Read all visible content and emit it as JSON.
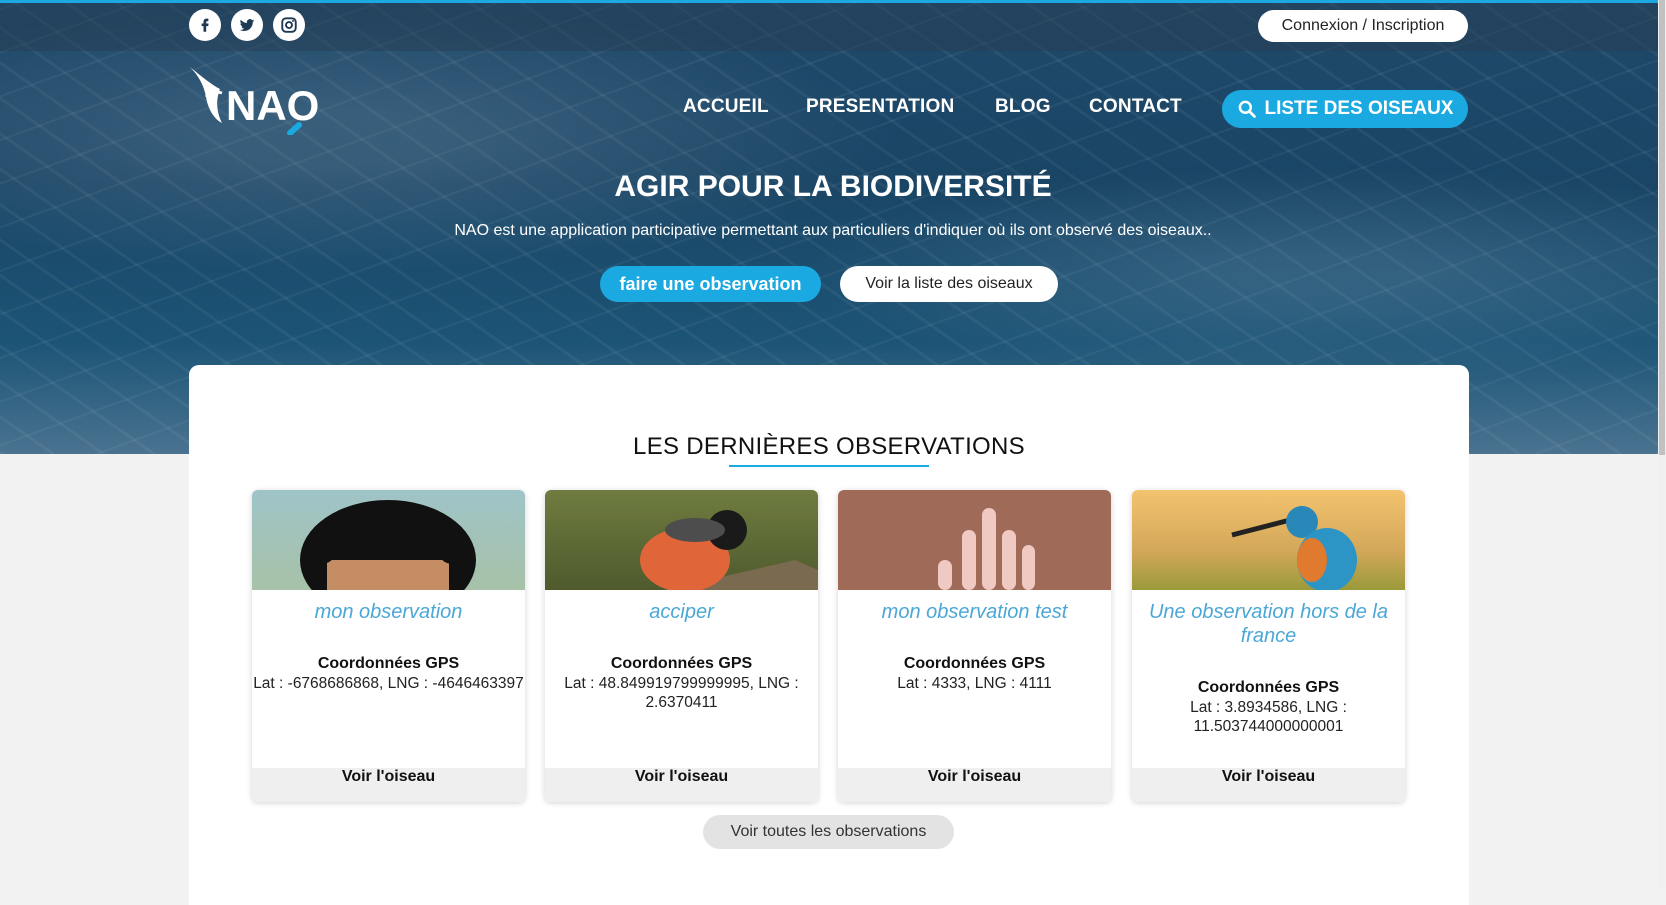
{
  "topbar": {
    "social": [
      {
        "icon": "facebook-icon"
      },
      {
        "icon": "twitter-icon"
      },
      {
        "icon": "instagram-icon"
      }
    ],
    "login_label": "Connexion / Inscription"
  },
  "nav": {
    "logo_text": "NAO",
    "links": [
      "ACCUEIL",
      "PRESENTATION",
      "BLOG",
      "CONTACT"
    ],
    "cta_label": "LISTE DES OISEAUX"
  },
  "hero": {
    "title": "AGIR POUR LA BIODIVERSITÉ",
    "subtitle": "NAO est une application participative permettant aux particuliers d'indiquer où ils ont observé des oiseaux..",
    "primary_btn": "faire une observation",
    "secondary_btn": "Voir la liste des oiseaux"
  },
  "observations": {
    "heading": "LES DERNIÈRES OBSERVATIONS",
    "cards": [
      {
        "title": "mon observation",
        "gps_label": "Coordonnées GPS",
        "gps_value": "Lat : -6768686868, LNG : -4646463397",
        "link": "Voir l'oiseau"
      },
      {
        "title": "acciper",
        "gps_label": "Coordonnées GPS",
        "gps_value": "Lat : 48.849919799999995, LNG : 2.6370411",
        "link": "Voir l'oiseau"
      },
      {
        "title": "mon observation test",
        "gps_label": "Coordonnées GPS",
        "gps_value": "Lat : 4333, LNG : 4111",
        "link": "Voir l'oiseau"
      },
      {
        "title": "Une observation hors de la france",
        "gps_label": "Coordonnées GPS",
        "gps_value": "Lat : 3.8934586, LNG : 11.503744000000001",
        "link": "Voir l'oiseau"
      }
    ],
    "all_label": "Voir toutes les observations"
  },
  "colors": {
    "accent": "#1ba9e1",
    "card_title": "#4aa7d6",
    "hero_bg": "#1d4a6b"
  }
}
